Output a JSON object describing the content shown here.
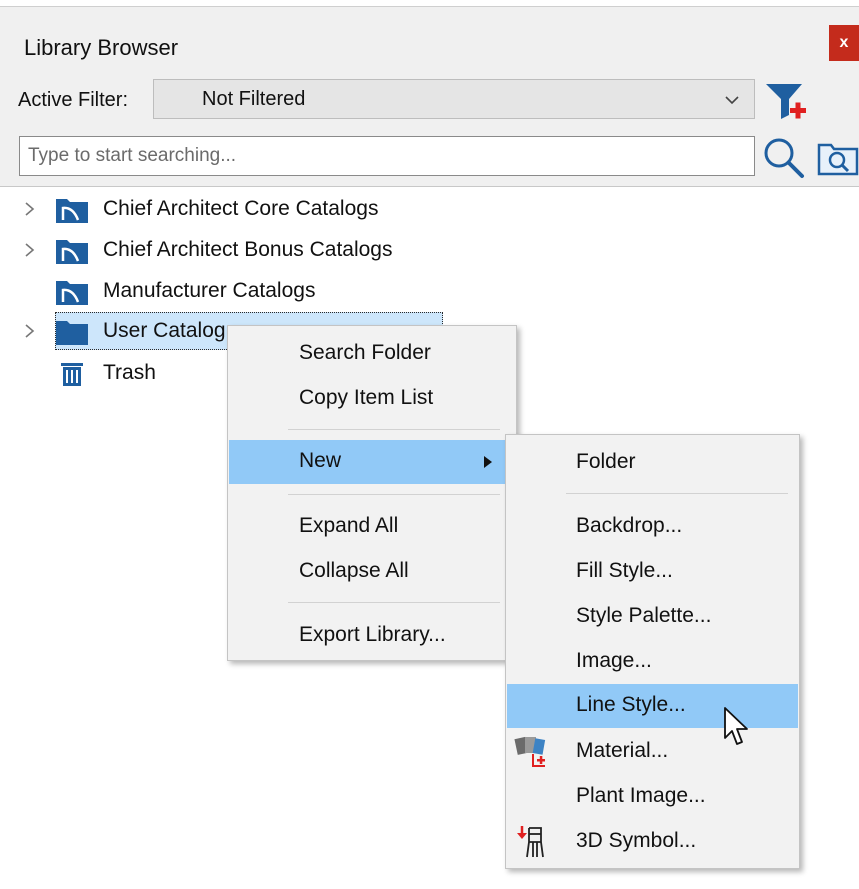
{
  "window": {
    "title": "Library Browser",
    "close_label": "x"
  },
  "filter": {
    "label": "Active Filter:",
    "value": "Not Filtered"
  },
  "search": {
    "placeholder": "Type to start searching..."
  },
  "tree": {
    "items": [
      {
        "label": "Chief Architect Core Catalogs",
        "icon": "catalog-folder-icon",
        "expandable": true
      },
      {
        "label": "Chief Architect Bonus Catalogs",
        "icon": "catalog-folder-icon",
        "expandable": true
      },
      {
        "label": "Manufacturer Catalogs",
        "icon": "catalog-folder-icon",
        "expandable": false
      },
      {
        "label": "User Catalog",
        "icon": "folder-icon",
        "expandable": true,
        "selected": true
      },
      {
        "label": "Trash",
        "icon": "trash-icon",
        "expandable": false
      }
    ]
  },
  "context_menu": {
    "items": [
      {
        "label": "Search Folder"
      },
      {
        "label": "Copy Item List"
      },
      {
        "label": "New",
        "highlighted": true,
        "has_submenu": true
      },
      {
        "label": "Expand All"
      },
      {
        "label": "Collapse All"
      },
      {
        "label": "Export Library..."
      }
    ]
  },
  "submenu": {
    "items": [
      {
        "label": "Folder"
      },
      {
        "label": "Backdrop..."
      },
      {
        "label": "Fill Style..."
      },
      {
        "label": "Style Palette..."
      },
      {
        "label": "Image..."
      },
      {
        "label": "Line Style...",
        "highlighted": true
      },
      {
        "label": "Material...",
        "icon": "material-icon"
      },
      {
        "label": "Plant Image..."
      },
      {
        "label": "3D Symbol...",
        "icon": "3d-symbol-icon"
      }
    ]
  },
  "colors": {
    "accent_highlight": "#91c9f7",
    "selection": "#cde6fb",
    "catalog_icon": "#1f5fa0",
    "close_button": "#c42b1c"
  }
}
